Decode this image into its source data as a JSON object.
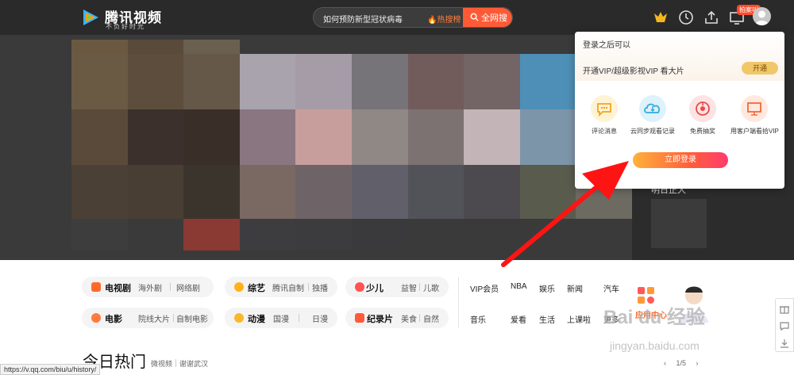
{
  "header": {
    "logo_text": "腾讯视频",
    "logo_slogan": "不负好时光",
    "search_value": "如何预防新型冠状病毒",
    "search_hot": "热搜榜",
    "search_button": "全网搜",
    "badge": "拍案叫",
    "colors": {
      "bar": "#2a2a2a",
      "accent": "#ff5a36"
    }
  },
  "popup": {
    "title": "登录之后可以",
    "vip_text": "开通VIP/超级影视VIP 看大片",
    "open_button": "开通",
    "features": [
      {
        "label": "评论消息",
        "icon": "comment-icon"
      },
      {
        "label": "云同步观看记录",
        "icon": "cloud-sync-icon"
      },
      {
        "label": "免费抽奖",
        "icon": "lottery-icon"
      },
      {
        "label": "用客户端看拾VIP",
        "icon": "monitor-icon"
      }
    ],
    "login_button": "立即登录"
  },
  "hero": {
    "side_text": "明日正大"
  },
  "nav": {
    "row1": {
      "tv": {
        "main": "电视剧",
        "subs": [
          "海外剧",
          "网络剧"
        ]
      },
      "variety": {
        "main": "综艺",
        "subs": [
          "腾讯自制",
          "独播"
        ]
      },
      "kids": {
        "main": "少儿",
        "subs": [
          "益智",
          "儿歌"
        ]
      },
      "links": [
        "VIP会员",
        "NBA",
        "娱乐",
        "新闻",
        "汽车"
      ]
    },
    "row2": {
      "movie": {
        "main": "电影",
        "subs": [
          "院线大片",
          "自制电影"
        ]
      },
      "anime": {
        "main": "动漫",
        "subs": [
          "国漫",
          "日漫"
        ]
      },
      "documentary": {
        "main": "纪录片",
        "subs": [
          "美食",
          "自然"
        ]
      },
      "links": [
        "音乐",
        "爱看",
        "生活",
        "上课啦",
        "更多"
      ]
    },
    "promo_text": "应用中心"
  },
  "today": {
    "title": "今日热门",
    "subs": [
      "微视频",
      "谢谢武汉"
    ],
    "pager": "1/5"
  },
  "status_url": "https://v.qq.com/biu/u/history/",
  "watermark": {
    "line1": "Bai du 经验",
    "line2": "jingyan.baidu.com"
  }
}
